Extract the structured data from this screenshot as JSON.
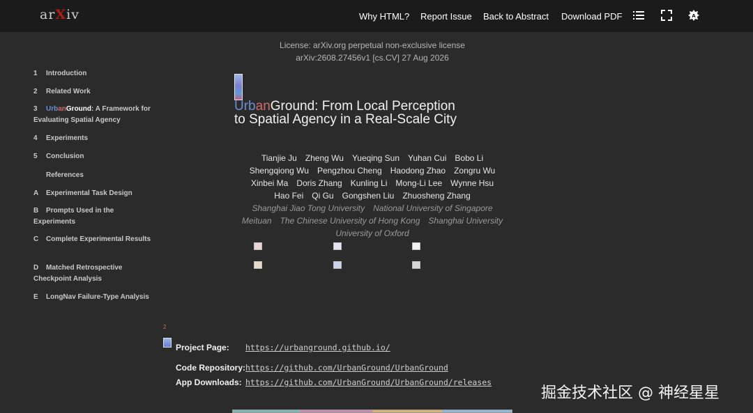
{
  "header": {
    "logo_ar": "ar",
    "logo_x": "X",
    "logo_iv": "iv",
    "links": [
      "Why HTML?",
      "Report Issue",
      "Back to Abstract",
      "Download PDF"
    ],
    "icons": [
      "list-icon",
      "fullscreen-icon",
      "theme-toggle-icon"
    ]
  },
  "toc": [
    {
      "num": "1",
      "label": "Introduction"
    },
    {
      "num": "2",
      "label": "Related Work"
    },
    {
      "num": "3",
      "label_parts": [
        "Urb",
        "an",
        "Ground"
      ],
      "label_rest": ": A Framework for Evaluating Spatial Agency"
    },
    {
      "num": "4",
      "label": "Experiments"
    },
    {
      "num": "5",
      "label": "Conclusion"
    },
    {
      "num": "",
      "label": "References"
    },
    {
      "num": "A",
      "label": "Experimental Task Design"
    },
    {
      "num": "B",
      "label": "Prompts Used in the Experiments"
    },
    {
      "num": "C",
      "label": "Complete Experimental Results"
    },
    {
      "num": "D",
      "label": "Matched Retrospective Checkpoint Analysis"
    },
    {
      "num": "E",
      "label": "LongNav Failure-Type Analysis"
    }
  ],
  "paper": {
    "license": "License: arXiv.org perpetual non-exclusive license",
    "arxiv_id": "arXiv:2608.27456v1 [cs.CV] 27 Aug 2026",
    "title_parts": [
      "Urb",
      "an",
      "Ground"
    ],
    "title_line1_rest": ": From Local Perception",
    "title_line2": "to Spatial Agency in a Real-Scale City",
    "author_rows": [
      [
        "Tianjie Ju",
        "Zheng Wu",
        "Yueqing Sun",
        "Yuhan Cui",
        "Bobo Li"
      ],
      [
        "Shengqiong Wu",
        "Pengzhou Cheng",
        "Haodong Zhao",
        "Zongru Wu"
      ],
      [
        "Xinbei Ma",
        "Doris Zhang",
        "Kunling Li",
        "Mong-Li Lee",
        "Wynne Hsu"
      ],
      [
        "Hao Fei",
        "Qi Gu",
        "Gongshen Liu",
        "Zhuosheng Zhang"
      ]
    ],
    "affiliation_rows": [
      [
        "Shanghai Jiao Tong University",
        "National University of Singapore"
      ],
      [
        "Meituan",
        "The Chinese University of Hong Kong",
        "Shanghai University"
      ],
      [
        "University of Oxford"
      ]
    ],
    "footnote_marker": "2",
    "links": [
      {
        "label": "Project Page:",
        "url": "https://urbanground.github.io/"
      },
      {
        "label": "Code Repository:",
        "url": "https://github.com/UrbanGround/UrbanGround"
      },
      {
        "label": "App Downloads:",
        "url": "https://github.com/UrbanGround/UrbanGround/releases"
      }
    ]
  },
  "watermark": "掘金技术社区 @ 神经星星",
  "colors": {
    "header_bg": "#1b1b1b",
    "page_bg": "#2b2b2b",
    "arxiv_red": "#b31b1b"
  }
}
